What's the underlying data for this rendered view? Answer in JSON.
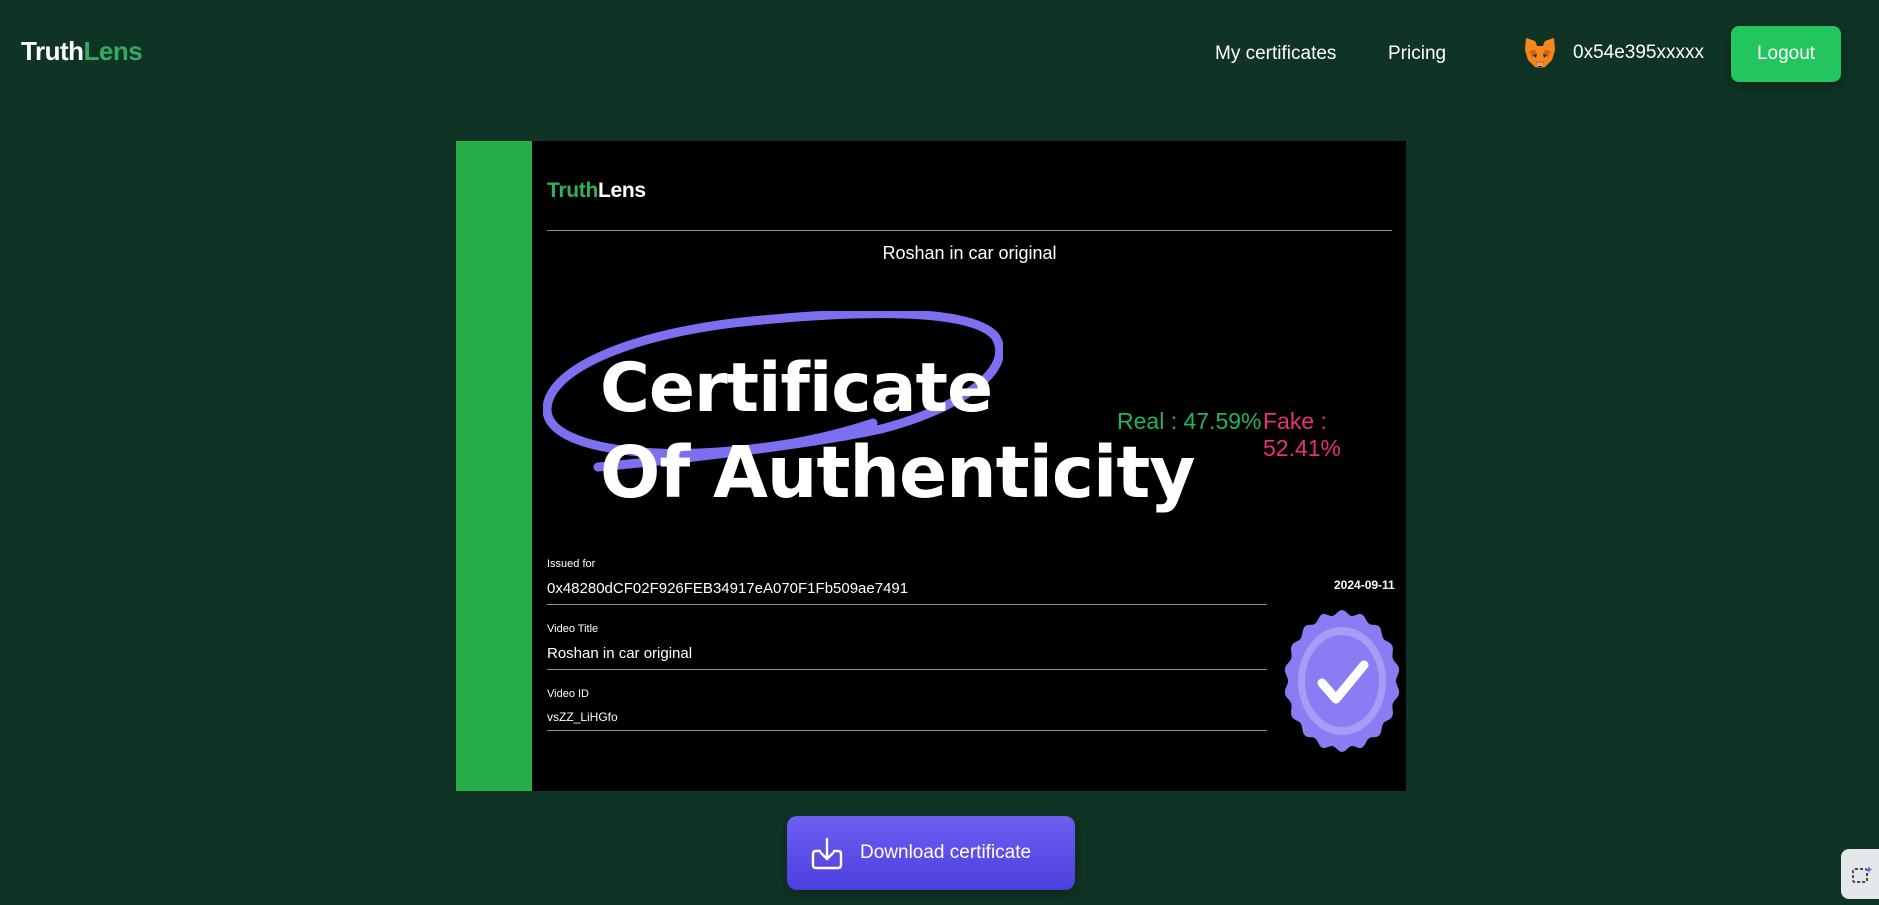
{
  "header": {
    "logo_part1": "Truth",
    "logo_part2": "Lens",
    "nav": [
      "My certificates",
      "Pricing"
    ],
    "wallet_address": "0x54e395xxxxx",
    "wallet_icon": "metamask-fox-icon",
    "logout_label": "Logout"
  },
  "certificate": {
    "logo_part1": "Truth",
    "logo_part2": "Lens",
    "subject": "Roshan in car original",
    "title_line1": "Certificate",
    "title_line2": "Of Authenticity",
    "real_text": "Real : 47.59%",
    "fake_text": "Fake : 52.41%",
    "fields": [
      {
        "label": "Issued for",
        "value": "0x48280dCF02F926FEB34917eA070F1Fb509ae7491"
      },
      {
        "label": "Video Title",
        "value": "Roshan in car original"
      },
      {
        "label": "Video ID",
        "value": "vsZZ_LiHGfo"
      }
    ],
    "date": "2024-09-11",
    "seal_icon": "verified-seal-checkmark-icon"
  },
  "download": {
    "label": "Download certificate",
    "icon": "download-icon"
  },
  "colors": {
    "page_background": "#0f3425",
    "brand_green": "#35a862",
    "logout_green": "#22c55e",
    "certificate_bar": "#27ad48",
    "real": "#22b35e",
    "fake": "#e6307c",
    "accent_purple": "#6d5ff0",
    "seal": "#8a7cf2"
  }
}
